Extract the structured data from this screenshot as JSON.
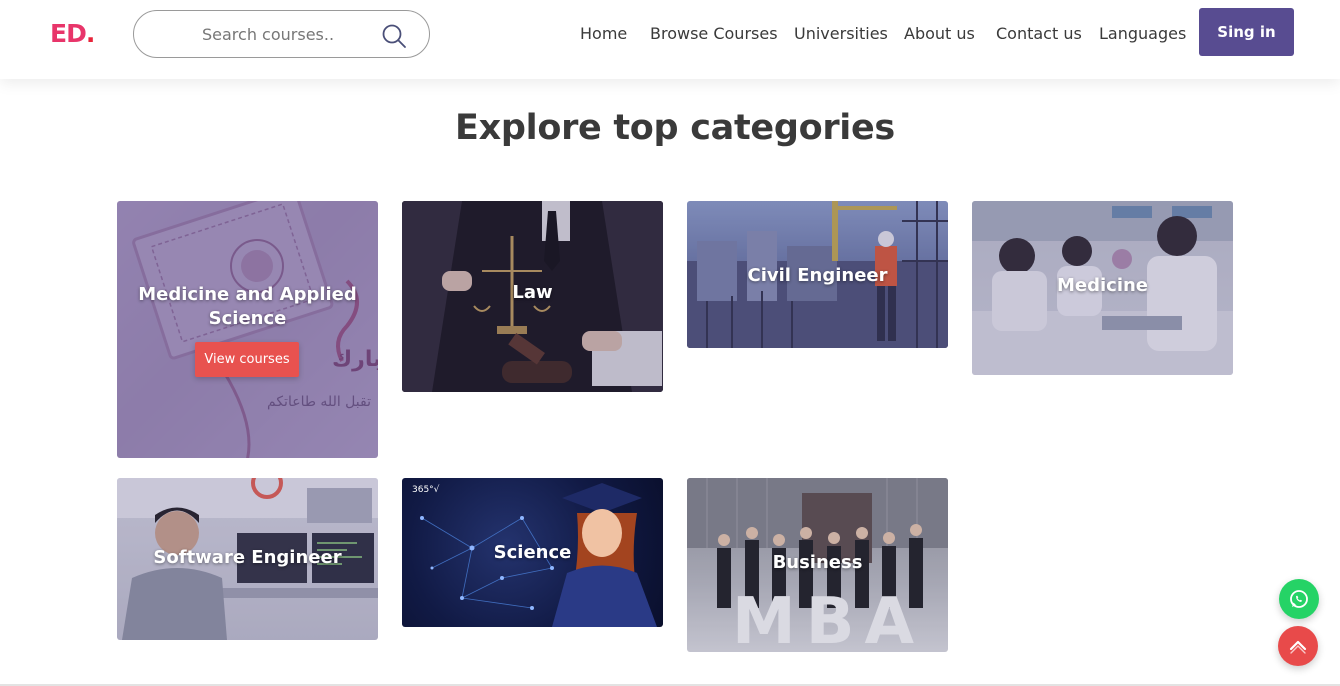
{
  "header": {
    "logo_main": "ED",
    "logo_dot": ".",
    "search_placeholder": "Search courses..",
    "nav": [
      "Home",
      "Browse Courses",
      "Universities",
      "About us",
      "Contact us",
      "Languages"
    ],
    "signin_label": "Sing in"
  },
  "main": {
    "title": "Explore top categories",
    "view_courses_label": "View courses",
    "categories": [
      {
        "title": "Medicine and Applied Science"
      },
      {
        "title": "Law"
      },
      {
        "title": "Civil Engineer"
      },
      {
        "title": "Medicine"
      },
      {
        "title": "Software Engineer"
      },
      {
        "title": "Science"
      },
      {
        "title": "Business"
      }
    ]
  },
  "decor": {
    "science_badge": "365°√",
    "mba_letters": "MBA"
  },
  "colors": {
    "brand_pink": "#e8356a",
    "signin_purple": "#584c91",
    "view_button": "#e8524f",
    "whatsapp": "#25d366",
    "scroll_top": "#e84a4a"
  },
  "icons": {
    "search": "search-icon",
    "whatsapp": "whatsapp-icon",
    "scroll_top": "chevron-up-icon"
  }
}
